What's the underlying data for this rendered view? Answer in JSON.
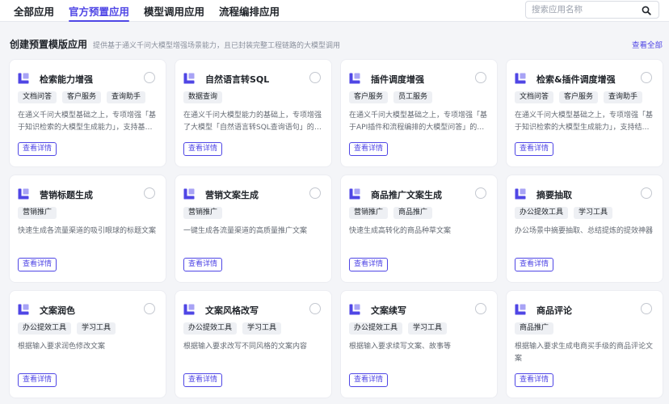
{
  "tabs": [
    {
      "label": "全部应用",
      "active": false
    },
    {
      "label": "官方预置应用",
      "active": true
    },
    {
      "label": "模型调用应用",
      "active": false
    },
    {
      "label": "流程编排应用",
      "active": false
    }
  ],
  "search": {
    "placeholder": "搜索应用名称",
    "icon": "search-icon"
  },
  "section": {
    "title": "创建预置模版应用",
    "description": "提供基于通义千问大模型增强场景能力，且已封装完整工程链路的大模型调用",
    "view_all": "查看全部"
  },
  "colors": {
    "accent": "#4f46e5",
    "tag_bg": "#eef0f4"
  },
  "detail_label": "查看详情",
  "cards": [
    {
      "title": "检索能力增强",
      "tags": [
        "文档问答",
        "客户服务",
        "查询助手"
      ],
      "desc": "在通义千问大模型基础之上，专项增强「基于知识检索的大模型生成能力」，支持基于企业私有知识库的文档问答"
    },
    {
      "title": "自然语言转SQL",
      "tags": [
        "数据查询"
      ],
      "desc": "在通义千问大模型能力的基础上，专项增强了大模型「自然语言转SQL查询语句」的能力"
    },
    {
      "title": "插件调度增强",
      "tags": [
        "客户服务",
        "员工服务"
      ],
      "desc": "在通义千问大模型基础之上，专项增强「基于API插件和流程编排的大模型问答」的能力"
    },
    {
      "title": "检索&插件调度增强",
      "tags": [
        "文档问答",
        "客户服务",
        "查询助手"
      ],
      "desc": "在通义千问大模型基础之上，专项增强「基于知识检索的大模型生成能力」，支持结合插件调度"
    },
    {
      "title": "营销标题生成",
      "tags": [
        "营销推广"
      ],
      "desc": "快速生成各流量渠道的吸引眼球的标题文案"
    },
    {
      "title": "营销文案生成",
      "tags": [
        "营销推广"
      ],
      "desc": "一键生成各流量渠道的高质量推广文案"
    },
    {
      "title": "商品推广文案生成",
      "tags": [
        "营销推广",
        "商品推广"
      ],
      "desc": "快速生成高转化的商品种草文案"
    },
    {
      "title": "摘要抽取",
      "tags": [
        "办公提效工具",
        "学习工具"
      ],
      "desc": "办公场景中摘要抽取、总结提炼的提效神器"
    },
    {
      "title": "文案润色",
      "tags": [
        "办公提效工具",
        "学习工具"
      ],
      "desc": "根据输入要求润色修改文案"
    },
    {
      "title": "文案风格改写",
      "tags": [
        "办公提效工具",
        "学习工具"
      ],
      "desc": "根据输入要求改写不同风格的文案内容"
    },
    {
      "title": "文案续写",
      "tags": [
        "办公提效工具",
        "学习工具"
      ],
      "desc": "根据输入要求续写文案、故事等"
    },
    {
      "title": "商品评论",
      "tags": [
        "商品推广"
      ],
      "desc": "根据输入要求生成电商买手级的商品评论文案"
    }
  ]
}
